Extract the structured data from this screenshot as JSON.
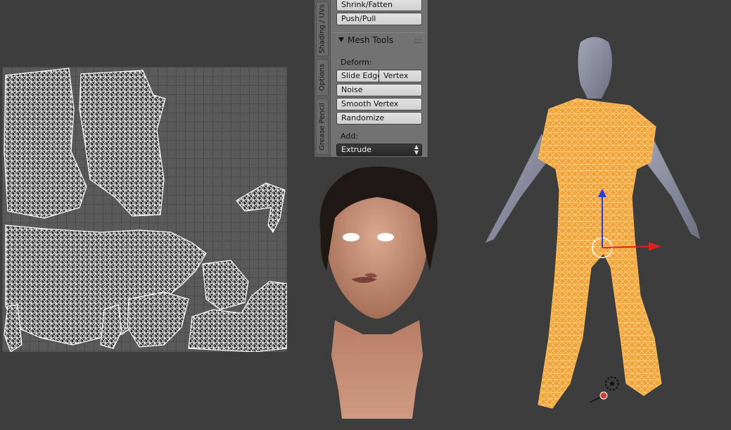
{
  "uv_editor": {
    "icon": "uv-wireframe"
  },
  "tool_panel": {
    "tabs": [
      "Shading / UVs",
      "Options",
      "Grease Pencil"
    ],
    "top_buttons": [
      "Shrink/Fatten",
      "Push/Pull"
    ],
    "panel_title": "Mesh Tools",
    "deform_label": "Deform:",
    "deform_buttons": {
      "slide_edge": "Slide Edge",
      "vertex": "Vertex",
      "noise": "Noise",
      "smooth_vertex": "Smooth Vertex",
      "randomize": "Randomize"
    },
    "add_label": "Add:",
    "add_select": {
      "selected": "Extrude"
    }
  },
  "viewport": {
    "head_model": "textured-female-head",
    "body_model": "wireframe-clothing-on-mannequin",
    "mesh_color": "#f5a030",
    "gizmo_colors": {
      "x": "#e02020",
      "z": "#2040e0"
    }
  }
}
